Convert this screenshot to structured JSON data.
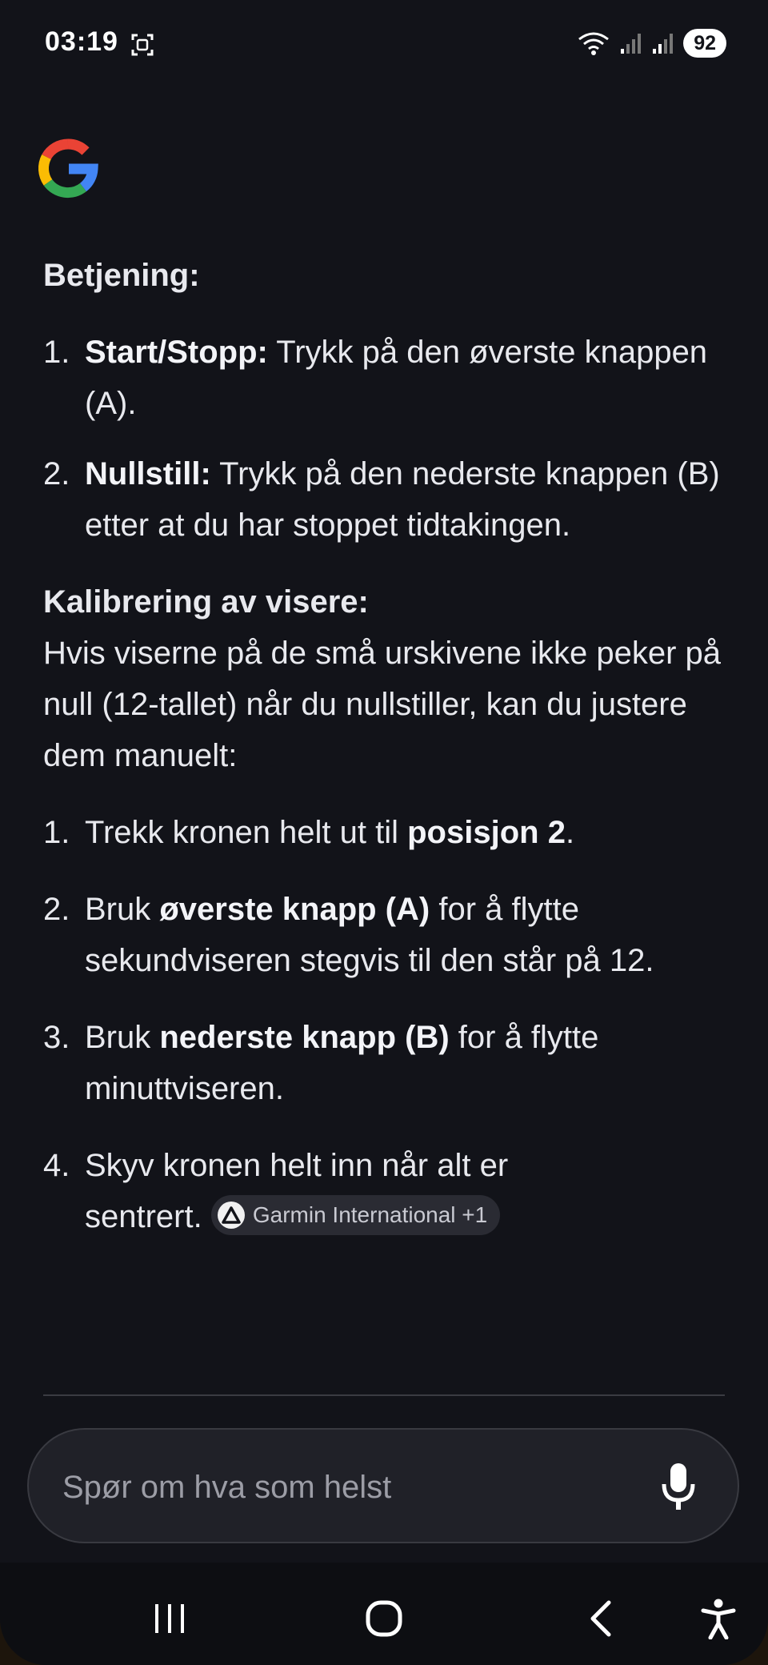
{
  "status_bar": {
    "time": "03:19",
    "battery": "92",
    "icons": [
      "screenshot-icon",
      "wifi-icon",
      "signal-icon",
      "signal-icon"
    ]
  },
  "section1": {
    "heading": "Betjening:",
    "items": [
      {
        "num": "1.",
        "bold": "Start/Stopp:",
        "text": " Trykk på den øverste knappen (A)."
      },
      {
        "num": "2.",
        "bold": "Nullstill:",
        "text": " Trykk på den nederste knappen (B) etter at du har stoppet tidtakingen."
      }
    ]
  },
  "section2": {
    "heading": "Kalibrering av visere:",
    "intro": "Hvis viserne på de små urskivene ikke peker på null (12-tallet) når du nullstiller, kan du justere dem manuelt:",
    "items": [
      {
        "num": "1.",
        "pre": "Trekk kronen helt ut til ",
        "bold": "posisjon 2",
        "post": "."
      },
      {
        "num": "2.",
        "pre": "Bruk ",
        "bold": "øverste knapp (A)",
        "post": " for å flytte sekundviseren stegvis til den står på 12."
      },
      {
        "num": "3.",
        "pre": "Bruk ",
        "bold": "nederste knapp (B)",
        "post": " for å flytte minuttviseren."
      },
      {
        "num": "4.",
        "pre": "Skyv kronen helt inn når alt er sentrert.",
        "bold": "",
        "post": ""
      }
    ],
    "source_chip": "Garmin International +1"
  },
  "ask_bar": {
    "placeholder": "Spør om hva som helst",
    "value": ""
  },
  "nav": {
    "buttons": [
      "recent-apps",
      "home",
      "back",
      "accessibility"
    ]
  }
}
